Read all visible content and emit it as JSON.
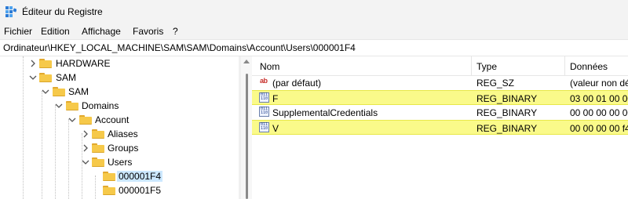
{
  "window": {
    "title": "Éditeur du Registre"
  },
  "menu": [
    "Fichier",
    "Edition",
    "Affichage",
    "Favoris",
    "?"
  ],
  "address": "Ordinateur\\HKEY_LOCAL_MACHINE\\SAM\\SAM\\Domains\\Account\\Users\\000001F4",
  "tree": [
    {
      "label": "HARDWARE",
      "state": "collapsed"
    },
    {
      "label": "SAM",
      "state": "expanded"
    },
    {
      "label": "SAM",
      "state": "expanded"
    },
    {
      "label": "Domains",
      "state": "expanded"
    },
    {
      "label": "Account",
      "state": "expanded"
    },
    {
      "label": "Aliases",
      "state": "collapsed"
    },
    {
      "label": "Groups",
      "state": "collapsed"
    },
    {
      "label": "Users",
      "state": "expanded"
    },
    {
      "label": "000001F4",
      "state": "selected"
    },
    {
      "label": "000001F5",
      "state": "leaf"
    }
  ],
  "list": {
    "headers": [
      "Nom",
      "Type",
      "Données"
    ],
    "rows": [
      {
        "name": "(par défaut)",
        "type": "REG_SZ",
        "data": "(valeur non dé",
        "icon": "string-value-icon",
        "highlight": false
      },
      {
        "name": "F",
        "type": "REG_BINARY",
        "data": "03 00 01 00 00",
        "icon": "binary-value-icon",
        "highlight": true
      },
      {
        "name": "SupplementalCredentials",
        "type": "REG_BINARY",
        "data": "00 00 00 00 00",
        "icon": "binary-value-icon",
        "highlight": false
      },
      {
        "name": "V",
        "type": "REG_BINARY",
        "data": "00 00 00 00 f4 0",
        "icon": "binary-value-icon",
        "highlight": true
      }
    ]
  },
  "colors": {
    "highlight": "#fafa8a",
    "selection": "#cce8ff",
    "folder": "#f6c94a"
  }
}
